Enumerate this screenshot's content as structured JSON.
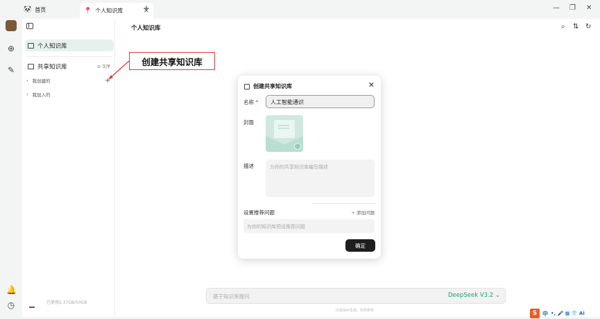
{
  "tabs": [
    {
      "label": "首页"
    },
    {
      "label": "个人知识库"
    }
  ],
  "new_tab_label": "+",
  "window_controls": {
    "minimize": "—",
    "maximize": "❐",
    "close": "✕"
  },
  "sidebar": {
    "personal": "个人知识库",
    "shared": "共享知识库",
    "sort_label": "⊘ 次序",
    "created": "我创建的",
    "joined": "我加入的",
    "add": "+",
    "usage": "已使用2.37GB/50GB"
  },
  "main": {
    "title": "个人知识库"
  },
  "callout": {
    "text": "创建共享知识库"
  },
  "modal": {
    "title": "创建共享知识库",
    "close": "✕",
    "name_label": "名称",
    "name_required": "*",
    "name_value": "人工智能通识",
    "cover_label": "封面",
    "desc_label": "描述",
    "desc_placeholder": "为你的共享知识库编写描述",
    "recommend_label": "设置推荐问题",
    "add_question": "+ 添加问题",
    "question_placeholder": "为你的知识库预设推荐问题",
    "confirm": "确定"
  },
  "ask_bar": {
    "placeholder": "基于知识库提问",
    "model": "DeepSeek V3.2 ⌄",
    "disclaimer": "内容由AI生成，仅供参考"
  },
  "ime": {
    "logo": "S",
    "lang": "中",
    "symbols": "•, 🎤 ▦ 👕 Ai"
  }
}
